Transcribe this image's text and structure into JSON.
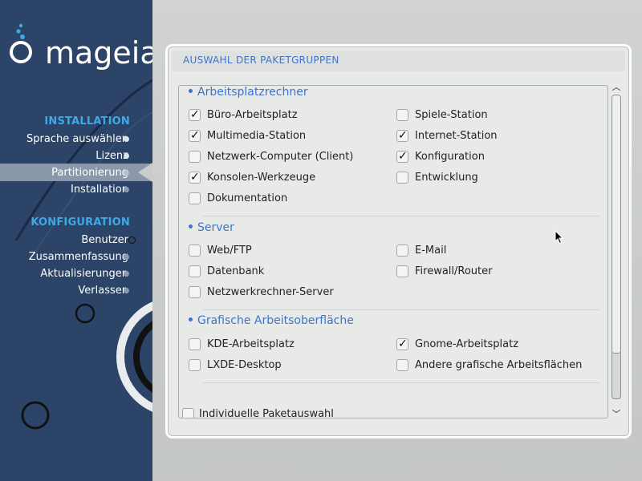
{
  "brand": {
    "logo_text": "mageia"
  },
  "sidebar": {
    "sections": [
      {
        "title": "INSTALLATION",
        "items": [
          {
            "label": "Sprache auswählen",
            "state": "done"
          },
          {
            "label": "Lizenz",
            "state": "done"
          },
          {
            "label": "Partitionierung",
            "state": "active"
          },
          {
            "label": "Installation",
            "state": "pending"
          }
        ]
      },
      {
        "title": "KONFIGURATION",
        "items": [
          {
            "label": "Benutzer",
            "state": "current-ring"
          },
          {
            "label": "Zusammenfassung",
            "state": "pending"
          },
          {
            "label": "Aktualisierungen",
            "state": "pending"
          },
          {
            "label": "Verlassen",
            "state": "pending"
          }
        ]
      }
    ]
  },
  "panel": {
    "title": "AUSWAHL DER PAKETGRUPPEN",
    "groups": [
      {
        "title": "Arbeitsplatzrechner",
        "options": [
          {
            "label": "Büro-Arbeitsplatz",
            "checked": true
          },
          {
            "label": "Spiele-Station",
            "checked": false
          },
          {
            "label": "Multimedia-Station",
            "checked": true
          },
          {
            "label": "Internet-Station",
            "checked": true
          },
          {
            "label": "Netzwerk-Computer (Client)",
            "checked": false
          },
          {
            "label": "Konfiguration",
            "checked": true
          },
          {
            "label": "Konsolen-Werkzeuge",
            "checked": true
          },
          {
            "label": "Entwicklung",
            "checked": false
          },
          {
            "label": "Dokumentation",
            "checked": false
          }
        ]
      },
      {
        "title": "Server",
        "options": [
          {
            "label": "Web/FTP",
            "checked": false
          },
          {
            "label": "E-Mail",
            "checked": false
          },
          {
            "label": "Datenbank",
            "checked": false
          },
          {
            "label": "Firewall/Router",
            "checked": false
          },
          {
            "label": "Netzwerkrechner-Server",
            "checked": false
          }
        ]
      },
      {
        "title": "Grafische Arbeitsoberfläche",
        "options": [
          {
            "label": "KDE-Arbeitsplatz",
            "checked": false
          },
          {
            "label": "Gnome-Arbeitsplatz",
            "checked": true
          },
          {
            "label": "LXDE-Desktop",
            "checked": false
          },
          {
            "label": "Andere grafische Arbeitsflächen",
            "checked": false
          }
        ]
      }
    ],
    "individual": {
      "label": "Individuelle Paketauswahl",
      "checked": false
    }
  },
  "colors": {
    "sidebar_bg": "#2b4468",
    "section_title": "#3fa9e6",
    "accent_blue": "#3f73c9",
    "panel_bg": "#e8eae8"
  }
}
